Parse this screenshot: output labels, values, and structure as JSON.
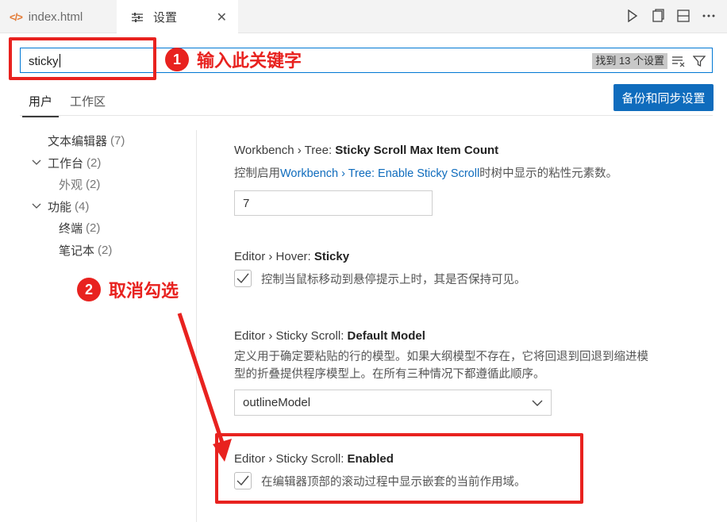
{
  "tabs": [
    {
      "label": "index.html",
      "icon": "code-icon"
    },
    {
      "label": "设置",
      "icon": "settings-icon",
      "close": "✕"
    }
  ],
  "search": {
    "value": "sticky",
    "found": "找到 13 个设置"
  },
  "annotations": {
    "step1_number": "1",
    "step1_text": "输入此关键字",
    "step2_number": "2",
    "step2_text": "取消勾选",
    "color": "#e8221f"
  },
  "scope_tabs": [
    "用户",
    "工作区"
  ],
  "sync_button": "备份和同步设置",
  "toc": [
    {
      "label": "文本编辑器",
      "count": "(7)",
      "expanded": null,
      "level": 0
    },
    {
      "label": "工作台",
      "count": "(2)",
      "expanded": true,
      "level": 0
    },
    {
      "label": "外观",
      "count": "(2)",
      "level": 1
    },
    {
      "label": "功能",
      "count": "(4)",
      "expanded": true,
      "level": 0
    },
    {
      "label": "终端",
      "count": "(2)",
      "level": 1
    },
    {
      "label": "笔记本",
      "count": "(2)",
      "level": 1
    }
  ],
  "settings": {
    "s1": {
      "prefix": "Workbench › Tree: ",
      "name": "Sticky Scroll Max Item Count",
      "desc_pre": "控制启用",
      "desc_link": "Workbench › Tree: Enable Sticky Scroll",
      "desc_post": "时树中显示的粘性元素数。",
      "value": "7"
    },
    "s2": {
      "prefix": "Editor › Hover: ",
      "name": "Sticky",
      "desc": "控制当鼠标移动到悬停提示上时，其是否保持可见。",
      "checked": true
    },
    "s3": {
      "prefix": "Editor › Sticky Scroll: ",
      "name": "Default Model",
      "desc_line1": "定义用于确定要粘贴的行的模型。如果大纲模型不存在，它将回退到回退到缩进模",
      "desc_line2": "型的折叠提供程序模型上。在所有三种情况下都遵循此顺序。",
      "value": "outlineModel"
    },
    "s4": {
      "prefix": "Editor › Sticky Scroll: ",
      "name": "Enabled",
      "desc": "在编辑器顶部的滚动过程中显示嵌套的当前作用域。",
      "checked": true
    }
  }
}
